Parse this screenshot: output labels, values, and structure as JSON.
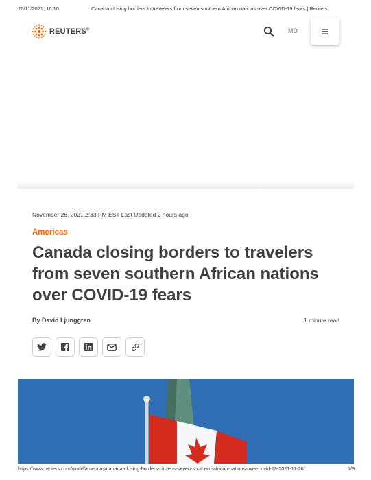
{
  "print_header": {
    "datetime": "26/11/2021, 16:10",
    "page_title": "Canada closing borders to travelers from seven southern African nations over COVID-19 fears | Reuters"
  },
  "topbar": {
    "logo_text": "REUTERS",
    "logo_mark": "®",
    "region": "MD",
    "icons": {
      "search": "search-icon",
      "menu": "hamburger-menu-icon"
    }
  },
  "article": {
    "dateline": "November 26, 2021 2:33 PM EST Last Updated 2 hours ago",
    "category": "Americas",
    "headline": "Canada closing borders to travelers from seven southern African nations over COVID-19 fears",
    "byline": "By David Ljunggren",
    "read_time": "1 minute read"
  },
  "share": [
    {
      "icon": "twitter-icon"
    },
    {
      "icon": "facebook-icon"
    },
    {
      "icon": "linkedin-icon"
    },
    {
      "icon": "email-icon"
    },
    {
      "icon": "link-icon"
    }
  ],
  "colors": {
    "accent": "#fa6400",
    "text": "#404040",
    "sky": "#2f6db4",
    "flag_red": "#d52b1e"
  },
  "print_footer": {
    "url": "https://www.reuters.com/world/americas/canada-closing-borders-citizens-seven-southern-african-nations-over-covid-19-2021-11-26/",
    "page": "1/9"
  }
}
